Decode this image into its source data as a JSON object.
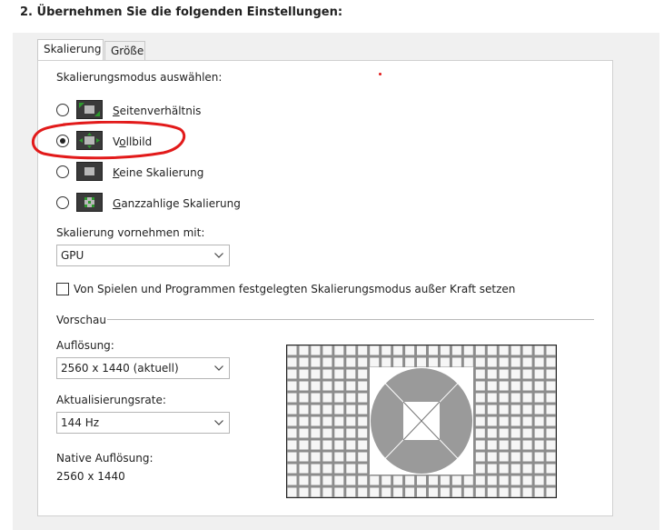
{
  "step_title": "2. Übernehmen Sie die folgenden Einstellungen:",
  "tabs": [
    {
      "label": "Skalierung",
      "active": true
    },
    {
      "label": "Größe",
      "active": false
    }
  ],
  "scaling": {
    "heading": "Skalierungsmodus auswählen:",
    "modes": [
      {
        "label_prefix": "",
        "label_accel": "S",
        "label_rest": "eitenverhältnis",
        "selected": false,
        "icon": "aspect-ratio-icon"
      },
      {
        "label_prefix": "V",
        "label_accel": "o",
        "label_rest": "llbild",
        "selected": true,
        "icon": "fullscreen-icon"
      },
      {
        "label_prefix": "",
        "label_accel": "K",
        "label_rest": "eine Skalierung",
        "selected": false,
        "icon": "no-scaling-icon"
      },
      {
        "label_prefix": "",
        "label_accel": "G",
        "label_rest": "anzzahlige Skalierung",
        "selected": false,
        "icon": "integer-scaling-icon"
      }
    ],
    "perform_label": "Skalierung vornehmen mit:",
    "perform_value": "GPU",
    "override_label": "Von Spielen und Programmen festgelegten Skalierungsmodus außer Kraft setzen",
    "override_checked": false
  },
  "preview": {
    "heading": "Vorschau",
    "resolution_label": "Auflösung:",
    "resolution_value": "2560 x 1440 (aktuell)",
    "refresh_label": "Aktualisierungsrate:",
    "refresh_value": "144 Hz",
    "native_label": "Native Auflösung:",
    "native_value": "2560 x 1440"
  },
  "colors": {
    "annotation": "#e21a1a",
    "icon_green": "#2e9a2e",
    "preview_grid": "#8c8c8c"
  }
}
